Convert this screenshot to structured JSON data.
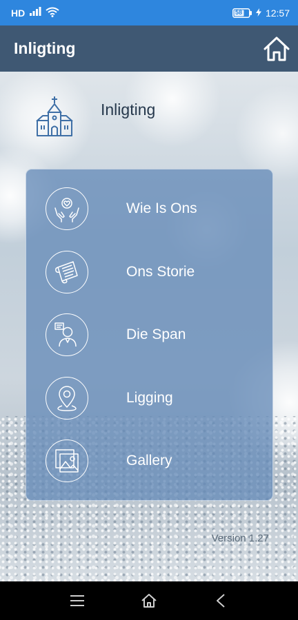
{
  "status_bar": {
    "network": "HD",
    "time": "12:57",
    "battery": "58"
  },
  "app_bar": {
    "title": "Inligting",
    "home_icon": "home-icon"
  },
  "section": {
    "title": "Inligting",
    "icon": "church-icon"
  },
  "menu": {
    "items": [
      {
        "label": "Wie Is Ons",
        "icon": "hands-heart-icon"
      },
      {
        "label": "Ons Storie",
        "icon": "scroll-icon"
      },
      {
        "label": "Die Span",
        "icon": "team-member-icon"
      },
      {
        "label": "Ligging",
        "icon": "location-pin-icon"
      },
      {
        "label": "Gallery",
        "icon": "gallery-icon"
      }
    ]
  },
  "footer": {
    "version": "Version 1.27"
  },
  "colors": {
    "status_bar": "#2e86de",
    "app_bar": "#3f5873",
    "card": "#678cb9"
  }
}
